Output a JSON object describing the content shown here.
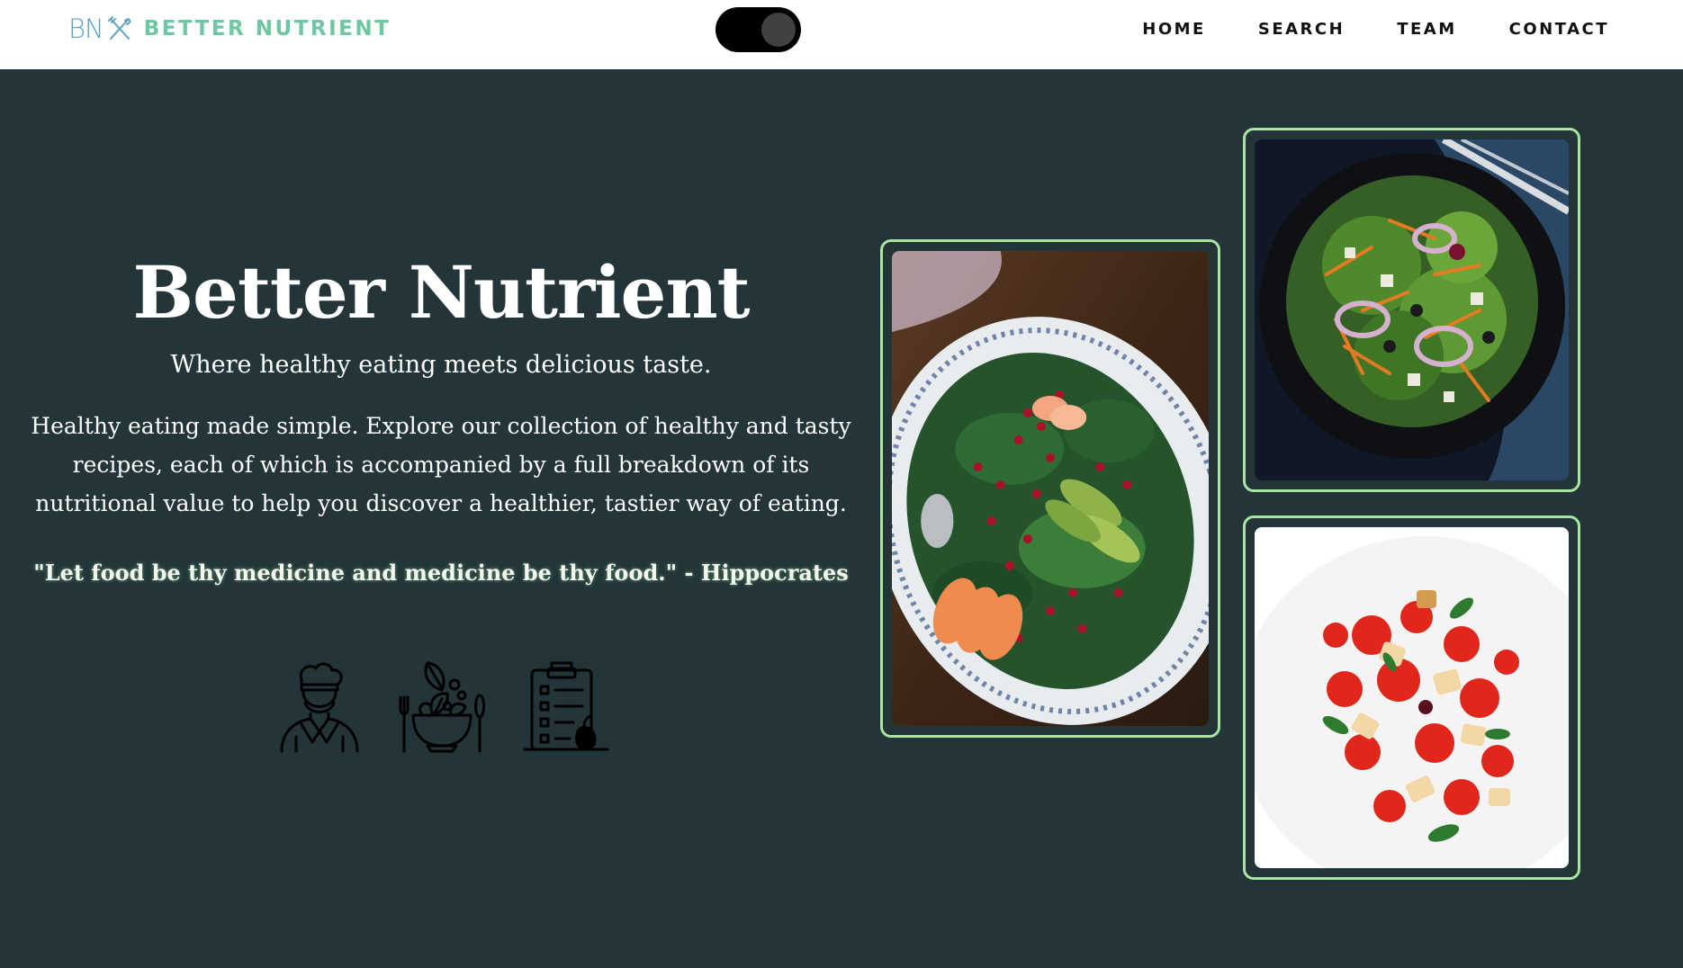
{
  "nav": {
    "logo_mark": "BN",
    "logo_text": "BETTER NUTRIENT",
    "links": [
      "HOME",
      "SEARCH",
      "TEAM",
      "CONTACT"
    ]
  },
  "theme_toggle": {
    "state": "dark"
  },
  "hero": {
    "title": "Better Nutrient",
    "tagline": "Where healthy eating meets delicious taste.",
    "description": "Healthy eating made simple. Explore our collection of healthy and tasty recipes, each of which is accompanied by a full breakdown of its nutritional value to help you discover a healthier, tastier way of eating.",
    "quote": "\"Let food be thy medicine and medicine be thy food.\" - Hippocrates"
  },
  "feature_icons": [
    "chef-icon",
    "salad-bowl-icon",
    "nutrition-clipboard-icon"
  ],
  "images": [
    "spinach-pomegranate-salad",
    "black-bowl-salad",
    "tomato-bread-salad"
  ],
  "colors": {
    "background": "#233538",
    "navbar": "#ffffff",
    "logo_mark": "#5aa4c2",
    "logo_text": "#6ec7a3",
    "card_border": "#a9e6a2"
  }
}
